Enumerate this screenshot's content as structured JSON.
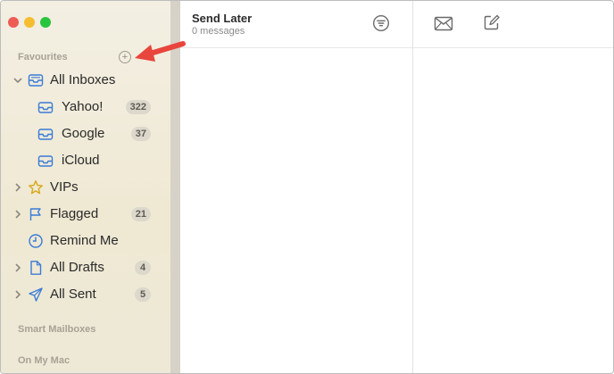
{
  "window": {
    "title": "Send Later",
    "message_count": "0 messages"
  },
  "sidebar": {
    "favourites_label": "Favourites",
    "favourites": [
      {
        "label": "All Inboxes",
        "icon": "inbox-stack-icon",
        "expanded": true,
        "badge": ""
      },
      {
        "label": "Yahoo!",
        "icon": "inbox-icon",
        "badge": "322"
      },
      {
        "label": "Google",
        "icon": "inbox-icon",
        "badge": "37"
      },
      {
        "label": "iCloud",
        "icon": "inbox-icon",
        "badge": ""
      },
      {
        "label": "VIPs",
        "icon": "star-icon",
        "expanded": false,
        "badge": ""
      },
      {
        "label": "Flagged",
        "icon": "flag-icon",
        "expanded": false,
        "badge": "21"
      },
      {
        "label": "Remind Me",
        "icon": "clock-icon",
        "badge": ""
      },
      {
        "label": "All Drafts",
        "icon": "draft-document-icon",
        "expanded": false,
        "badge": "4"
      },
      {
        "label": "All Sent",
        "icon": "paper-plane-icon",
        "expanded": false,
        "badge": "5"
      }
    ],
    "smart_mailboxes_label": "Smart Mailboxes",
    "on_my_mac_label": "On My Mac"
  },
  "colors": {
    "accent": "#3a7bd5",
    "annotation_arrow": "#e8453c",
    "vip_star": "#d9a716"
  }
}
